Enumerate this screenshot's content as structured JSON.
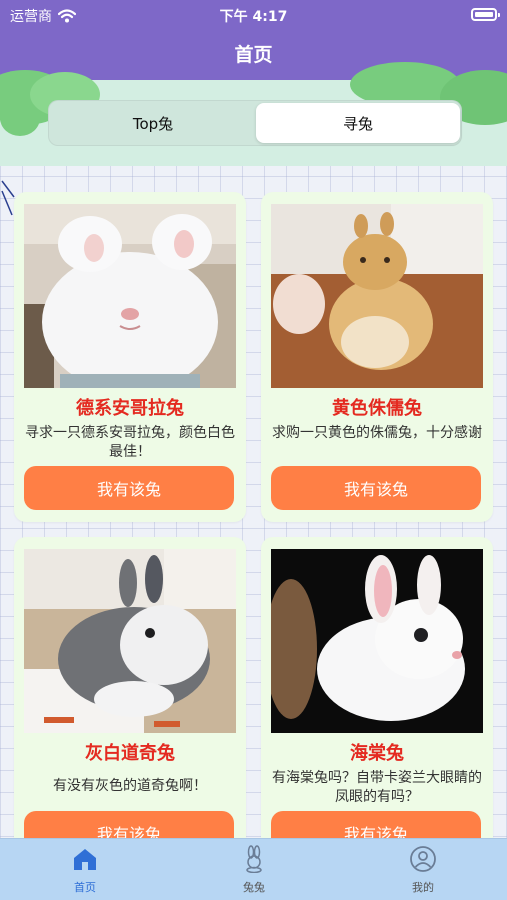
{
  "status_bar": {
    "carrier": "运营商",
    "time": "下午 4:17"
  },
  "nav": {
    "title": "首页"
  },
  "segment": {
    "items": [
      "Top兔",
      "寻兔"
    ],
    "selected": "寻兔"
  },
  "cards": [
    {
      "title": "德系安哥拉兔",
      "description": "寻求一只德系安哥拉兔，颜色白色最佳！",
      "button": "我有该兔",
      "image": "white-angora-rabbit-photo"
    },
    {
      "title": "黄色侏儒兔",
      "description": "求购一只黄色的侏儒兔，十分感谢",
      "button": "我有该兔",
      "image": "yellow-dwarf-rabbit-photo"
    },
    {
      "title": "灰白道奇兔",
      "description": "有没有灰色的道奇兔啊！",
      "button": "我有该兔",
      "image": "gray-white-dutch-rabbit-photo"
    },
    {
      "title": "海棠兔",
      "description": "有海棠兔吗？自带卡姿兰大眼睛的凤眼的有吗？",
      "button": "我有该兔",
      "image": "white-hotot-rabbit-photo"
    }
  ],
  "tabbar": {
    "items": [
      {
        "label": "首页",
        "icon": "home-icon",
        "active": true
      },
      {
        "label": "兔兔",
        "icon": "rabbit-icon",
        "active": false
      },
      {
        "label": "我的",
        "icon": "user-icon",
        "active": false
      }
    ]
  },
  "colors": {
    "nav_bg": "#7e68c8",
    "card_title": "#e42a20",
    "button_bg": "#ff7f45",
    "card_bg": "#eefbe6",
    "tabbar_bg": "#b7d6f3",
    "tab_active": "#2f6fd6"
  }
}
